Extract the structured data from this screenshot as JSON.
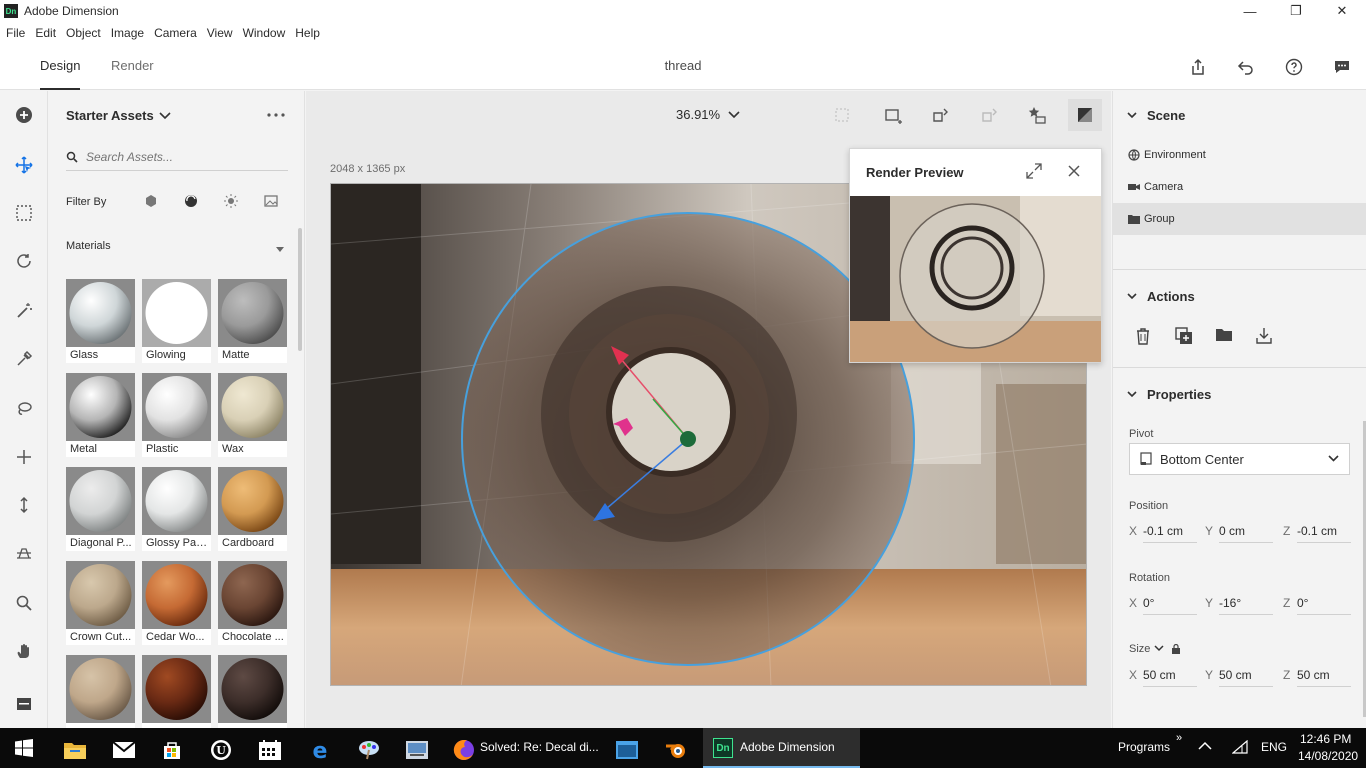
{
  "window": {
    "title": "Adobe Dimension",
    "icon_text": "Dn",
    "min": "—",
    "max": "❐",
    "close": "✕"
  },
  "menu": [
    "File",
    "Edit",
    "Object",
    "Image",
    "Camera",
    "View",
    "Window",
    "Help"
  ],
  "tabs": {
    "design": "Design",
    "render": "Render"
  },
  "document_title": "thread",
  "assets": {
    "title": "Starter Assets",
    "search_placeholder": "Search Assets...",
    "filter_label": "Filter By",
    "section": "Materials",
    "materials": [
      "Glass",
      "Glowing",
      "Matte",
      "Metal",
      "Plastic",
      "Wax",
      "Diagonal P...",
      "Glossy Pap...",
      "Cardboard",
      "Crown Cut...",
      "Cedar Wo...",
      "Chocolate ...",
      "",
      "",
      ""
    ]
  },
  "canvas": {
    "zoom": "36.91%",
    "size_label": "2048 x 1365 px"
  },
  "render_preview": {
    "title": "Render Preview"
  },
  "scene": {
    "title": "Scene",
    "items": [
      "Environment",
      "Camera",
      "Group"
    ]
  },
  "actions": {
    "title": "Actions"
  },
  "properties": {
    "title": "Properties",
    "pivot_label": "Pivot",
    "pivot_value": "Bottom Center",
    "position_label": "Position",
    "position": {
      "x": "-0.1 cm",
      "y": "0 cm",
      "z": "-0.1 cm"
    },
    "rotation_label": "Rotation",
    "rotation": {
      "x": "0°",
      "y": "-16°",
      "z": "0°"
    },
    "size_label": "Size",
    "size": {
      "x": "50 cm",
      "y": "50 cm",
      "z": "50 cm"
    },
    "axis": {
      "x": "X",
      "y": "Y",
      "z": "Z"
    }
  },
  "taskbar": {
    "firefox_label": "Solved: Re: Decal di...",
    "dimension_label": "Adobe Dimension",
    "dn_text": "Dn",
    "programs": "Programs",
    "chevron": "»",
    "lang": "ENG",
    "time": "12:46 PM",
    "date": "14/08/2020"
  }
}
